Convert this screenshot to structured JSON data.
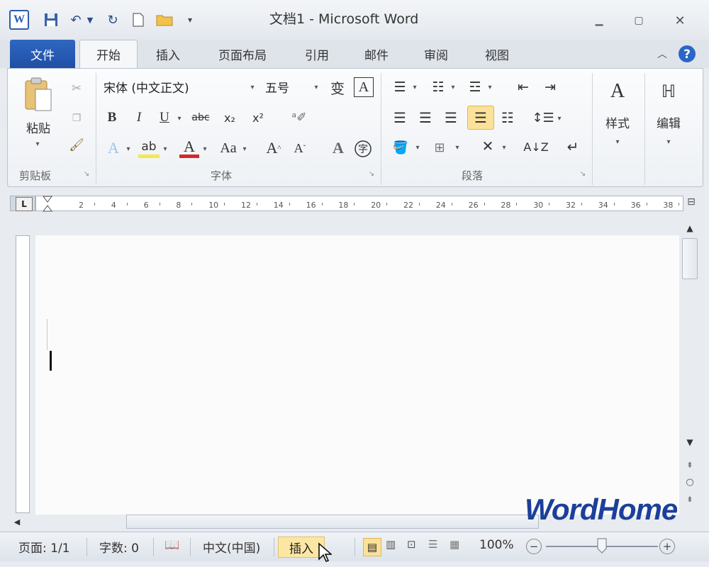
{
  "window": {
    "title": "文档1 - Microsoft Word"
  },
  "quick_access": {
    "undo": "↶",
    "redo": "↻"
  },
  "tabs": {
    "file": "文件",
    "items": [
      "开始",
      "插入",
      "页面布局",
      "引用",
      "邮件",
      "审阅",
      "视图"
    ]
  },
  "ribbon": {
    "clipboard": {
      "paste": "粘贴",
      "label": "剪贴板"
    },
    "font": {
      "name": "宋体 (中文正文)",
      "size": "五号",
      "label": "字体"
    },
    "paragraph": {
      "label": "段落"
    },
    "styles": {
      "label": "样式"
    },
    "editing": {
      "label": "编辑"
    }
  },
  "ruler": {
    "ticks": [
      "2",
      "4",
      "6",
      "8",
      "10",
      "12",
      "14",
      "16",
      "18",
      "20",
      "22",
      "24",
      "26",
      "28",
      "30",
      "32",
      "34",
      "36",
      "38"
    ]
  },
  "status": {
    "page": "页面: 1/1",
    "words": "字数: 0",
    "language": "中文(中国)",
    "insert_mode": "插入",
    "zoom": "100%"
  },
  "watermark": "WordHome"
}
